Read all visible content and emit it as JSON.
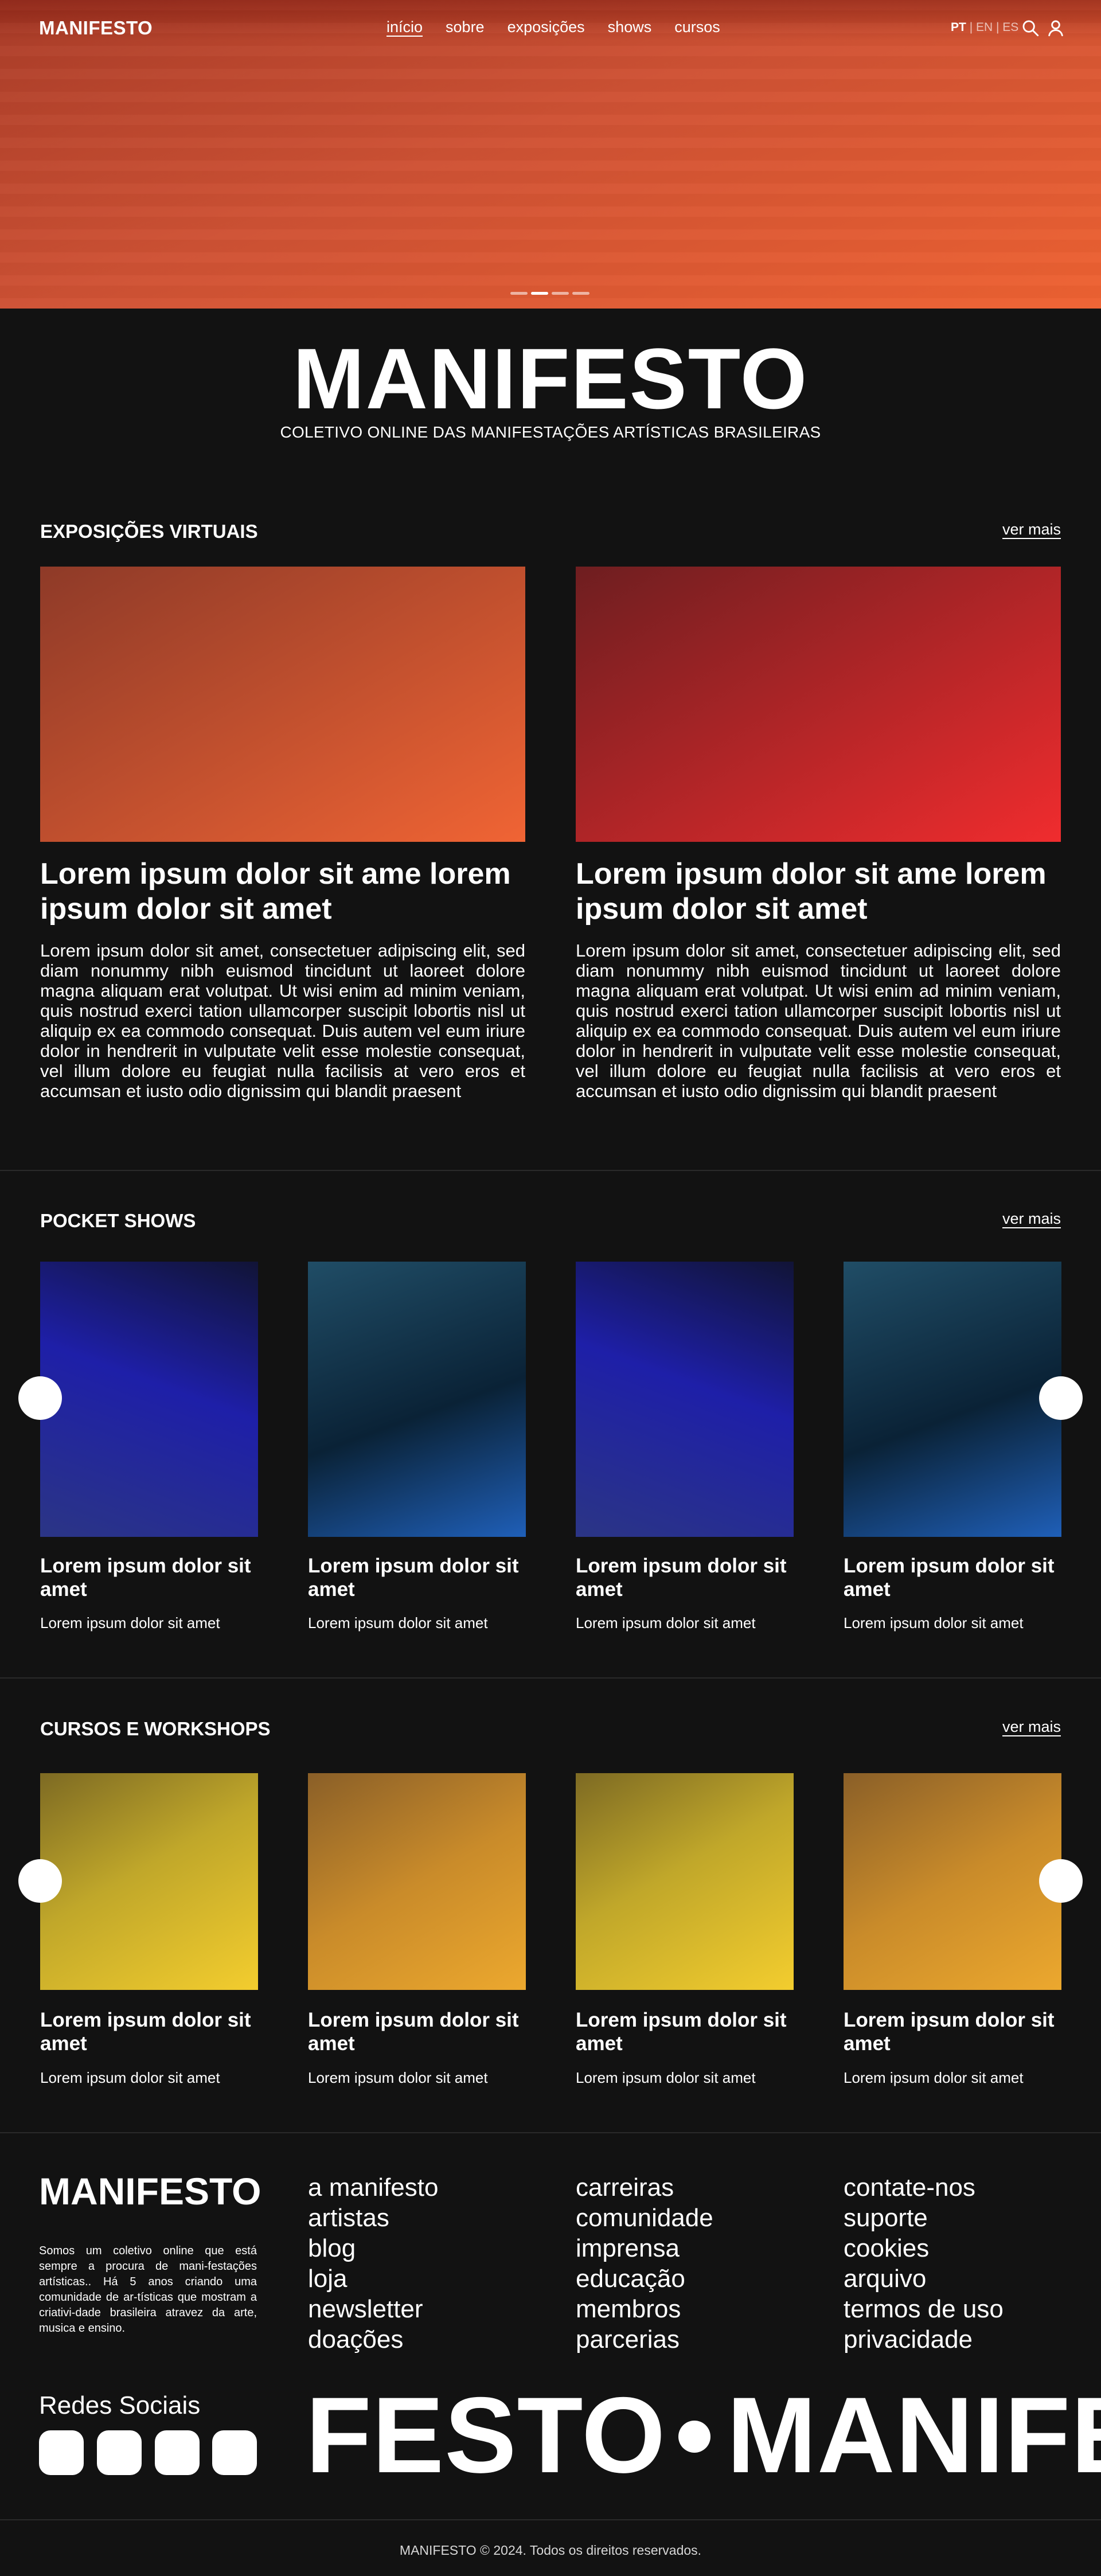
{
  "header": {
    "logo": "MANIFESTO",
    "nav": [
      "início",
      "sobre",
      "exposições",
      "shows",
      "cursos"
    ],
    "lang": {
      "active": "PT",
      "rest": "EN | ES",
      "sep": "|"
    },
    "icons": [
      "search-icon",
      "user-icon"
    ],
    "carousel_dots": 4,
    "carousel_active": 1
  },
  "brand": {
    "title": "MANIFESTO",
    "subtitle": "COLETIVO ONLINE DAS MANIFESTAÇÕES ARTÍSTICAS BRASILEIRAS"
  },
  "exposicoes": {
    "title": "EXPOSIÇÕES VIRTUAIS",
    "more": "ver mais",
    "items": [
      {
        "title": "Lorem ipsum dolor sit ame lorem ipsum dolor sit amet",
        "text": "Lorem ipsum dolor sit amet, consectetuer adipiscing elit, sed diam nonummy nibh euismod tincidunt ut laoreet dolore magna aliquam erat volutpat. Ut wisi enim ad minim veniam, quis nostrud exerci tation ullamcorper suscipit lobortis nisl ut aliquip ex ea commodo consequat. Duis autem vel eum iriure dolor in hendrerit in vulputate velit esse molestie consequat, vel illum dolore eu feugiat nulla facilisis at vero eros et accumsan et iusto odio dignissim qui blandit praesent",
        "colors": [
          "#8e3a28",
          "#f06434"
        ]
      },
      {
        "title": "Lorem ipsum dolor sit ame lorem ipsum dolor sit amet",
        "text": "Lorem ipsum dolor sit amet, consectetuer adipiscing elit, sed diam nonummy nibh euismod tincidunt ut laoreet dolore magna aliquam erat volutpat. Ut wisi enim ad minim veniam, quis nostrud exerci tation ullamcorper suscipit lobortis nisl ut aliquip ex ea commodo consequat. Duis autem vel eum iriure dolor in hendrerit in vulputate velit esse molestie consequat, vel illum dolore eu feugiat nulla facilisis at vero eros et accumsan et iusto odio dignissim qui blandit praesent",
        "colors": [
          "#6e1e20",
          "#f02c2e"
        ]
      }
    ]
  },
  "shows": {
    "title": "POCKET SHOWS",
    "more": "ver mais",
    "items": [
      {
        "title": "Lorem ipsum dolor sit amet",
        "subtitle": "Lorem ipsum dolor sit amet"
      },
      {
        "title": "Lorem ipsum dolor sit amet",
        "subtitle": "Lorem ipsum dolor sit amet"
      },
      {
        "title": "Lorem ipsum dolor sit amet",
        "subtitle": "Lorem ipsum dolor sit amet"
      },
      {
        "title": "Lorem ipsum dolor sit amet",
        "subtitle": "Lorem ipsum dolor sit amet"
      }
    ]
  },
  "cursos": {
    "title": "CURSOS E WORKSHOPS",
    "more": "ver mais",
    "items": [
      {
        "title": "Lorem ipsum dolor sit amet",
        "subtitle": "Lorem ipsum dolor sit amet"
      },
      {
        "title": "Lorem ipsum dolor sit amet",
        "subtitle": "Lorem ipsum dolor sit amet"
      },
      {
        "title": "Lorem ipsum dolor sit amet",
        "subtitle": "Lorem ipsum dolor sit amet"
      },
      {
        "title": "Lorem ipsum dolor sit amet",
        "subtitle": "Lorem ipsum dolor sit amet"
      }
    ]
  },
  "footer": {
    "logo": "MANIFESTO",
    "description": "Somos um coletivo online que está sempre a procura de mani-festações artísticas.. Há 5 anos criando uma comunidade de ar-tísticas que mostram a criativi-dade brasileira atravez da arte, musica e ensino.",
    "columns": [
      [
        "a manifesto",
        "artistas",
        "blog",
        "loja",
        "newsletter",
        "doações"
      ],
      [
        "carreiras",
        "comunidade",
        "imprensa",
        "educação",
        "membros",
        "parcerias"
      ],
      [
        "contate-nos",
        "suporte",
        "cookies",
        "arquivo",
        "termos de uso",
        "privacidade"
      ]
    ],
    "social_title": "Redes Sociais",
    "marquee_left": "FESTO",
    "marquee_right": "MANIFE",
    "copyright": "MANIFESTO © 2024. Todos os direitos reservados."
  }
}
